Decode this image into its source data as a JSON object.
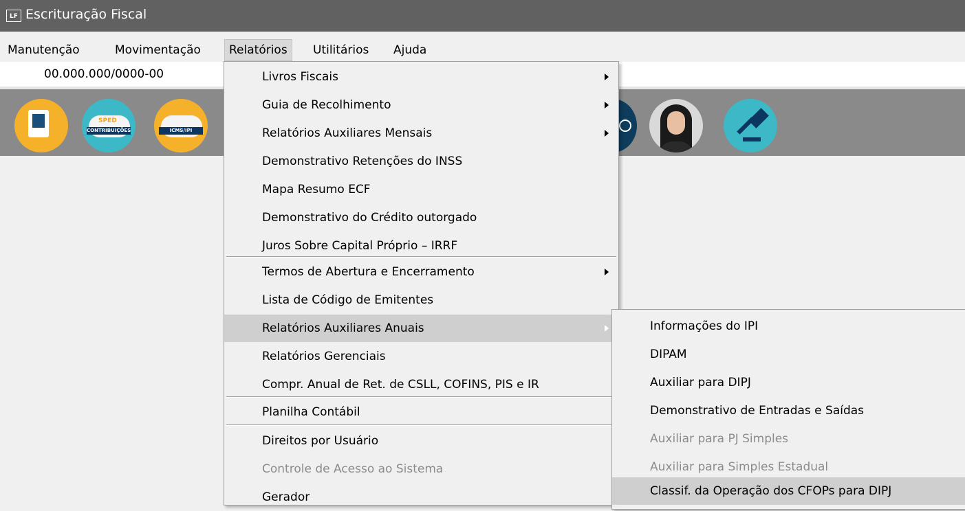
{
  "window": {
    "title": "Escrituração Fiscal",
    "icon_text": "LF"
  },
  "menubar": [
    {
      "label": "Manutenção"
    },
    {
      "label": "Movimentação"
    },
    {
      "label": "Relatórios"
    },
    {
      "label": "Utilitários"
    },
    {
      "label": "Ajuda"
    }
  ],
  "company": {
    "cnpj": "00.000.000/0000-00"
  },
  "toolbar": {
    "sped_top": "SPED",
    "sped_band": "CONTRIBUIÇÕES",
    "icms_band": "ICMS/IPI"
  },
  "relatorios_menu": [
    {
      "label": "Livros Fiscais",
      "submenu": true
    },
    {
      "label": "Guia de Recolhimento",
      "submenu": true
    },
    {
      "label": "Relatórios Auxiliares Mensais",
      "submenu": true
    },
    {
      "label": "Demonstrativo Retenções do INSS"
    },
    {
      "label": "Mapa Resumo ECF"
    },
    {
      "label": "Demonstrativo do Crédito outorgado"
    },
    {
      "label": "Juros Sobre Capital Próprio – IRRF"
    },
    {
      "label": "Termos de Abertura e Encerramento",
      "submenu": true
    },
    {
      "label": "Lista de Código de Emitentes"
    },
    {
      "label": "Relatórios Auxiliares Anuais",
      "submenu": true,
      "highlighted": true
    },
    {
      "label": "Relatórios Gerenciais"
    },
    {
      "label": "Compr. Anual de Ret. de CSLL, COFINS,  PIS e IR"
    },
    {
      "label": "Planilha Contábil"
    },
    {
      "label": "Direitos por Usuário"
    },
    {
      "label": "Controle de Acesso ao Sistema",
      "disabled": true
    },
    {
      "label": "Gerador"
    }
  ],
  "anuais_submenu": [
    {
      "label": "Informações do IPI"
    },
    {
      "label": "DIPAM"
    },
    {
      "label": "Auxiliar para DIPJ"
    },
    {
      "label": "Demonstrativo de Entradas e Saídas"
    },
    {
      "label": "Auxiliar para PJ Simples",
      "disabled": true
    },
    {
      "label": "Auxiliar para Simples Estadual",
      "disabled": true
    },
    {
      "label": "Classif. da Operação dos CFOPs para DIPJ",
      "highlighted": true
    }
  ]
}
